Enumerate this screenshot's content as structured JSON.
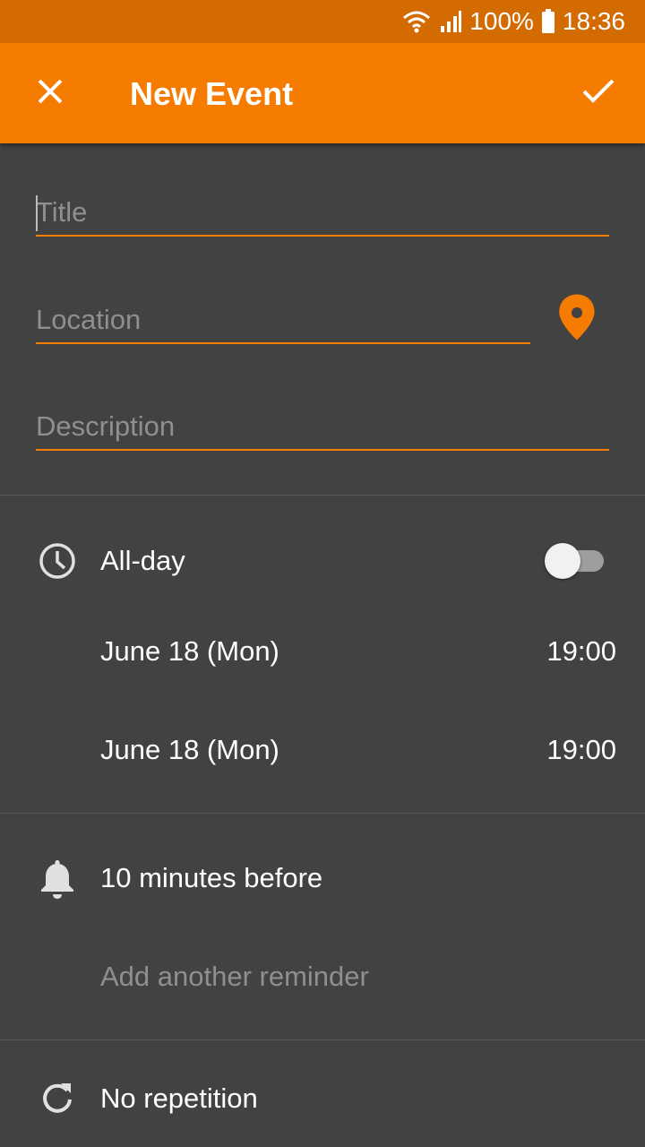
{
  "status_bar": {
    "battery": "100%",
    "time": "18:36"
  },
  "app_bar": {
    "title": "New Event",
    "close_icon": "close-icon",
    "confirm_icon": "check-icon"
  },
  "form": {
    "title_placeholder": "Title",
    "location_placeholder": "Location",
    "description_placeholder": "Description",
    "location_icon": "map-pin-icon"
  },
  "time": {
    "all_day_label": "All-day",
    "all_day_on": false,
    "start_date": "June 18 (Mon)",
    "start_time": "19:00",
    "end_date": "June 18 (Mon)",
    "end_time": "19:00"
  },
  "reminders": {
    "current": "10 minutes before",
    "add_label": "Add another reminder"
  },
  "repetition": {
    "label": "No repetition"
  },
  "colors": {
    "accent": "#f57c00",
    "status_bar": "#d36b00",
    "background": "#424242"
  }
}
